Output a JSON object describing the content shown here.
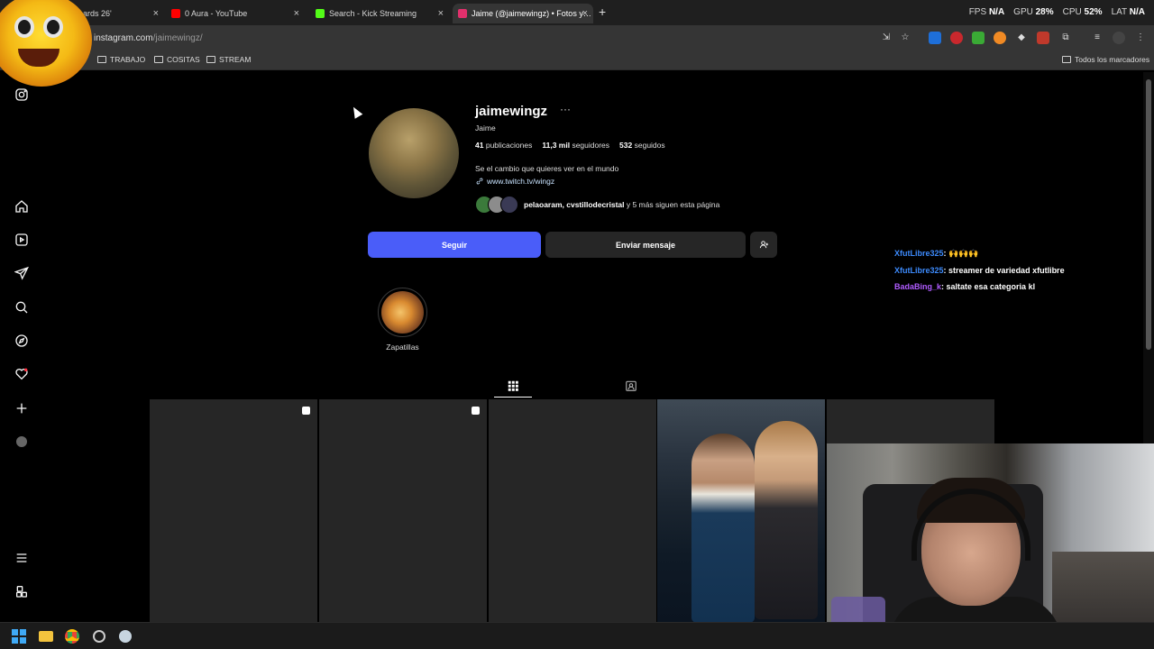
{
  "browser": {
    "tabs": [
      {
        "title": "ards 26'",
        "favicon_color": "#2c2c2c"
      },
      {
        "title": "0 Aura - YouTube",
        "favicon_color": "#ff0000"
      },
      {
        "title": "Search - Kick Streaming",
        "favicon_color": "#53fc18"
      },
      {
        "title": "Jaime (@jaimewingz) • Fotos y…",
        "favicon_color": "#e1306c"
      }
    ],
    "url_host": "instagram.com",
    "url_path": "/jaimewingz/",
    "bookmarks": [
      "TRABAJO",
      "COSITAS",
      "STREAM"
    ],
    "all_bookmarks": "Todos los marcadores"
  },
  "overlay_stats": {
    "fps_label": "FPS",
    "fps_value": "N/A",
    "gpu_label": "GPU",
    "gpu_value": "28%",
    "cpu_label": "CPU",
    "cpu_value": "52%",
    "lat_label": "LAT",
    "lat_value": "N/A"
  },
  "nav_icons": [
    "instagram-logo-icon",
    "home-icon",
    "reels-icon",
    "direct-messages-icon",
    "search-icon",
    "explore-icon",
    "notifications-icon",
    "create-icon",
    "profile-avatar",
    "menu-icon",
    "more-apps-icon"
  ],
  "profile": {
    "username": "jaimewingz",
    "more": "···",
    "full_name": "Jaime",
    "posts_count": "41",
    "posts_label": "publicaciones",
    "followers_count": "11,3 mil",
    "followers_label": "seguidores",
    "following_count": "532",
    "following_label": "seguidos",
    "bio": "Se el cambio que quieres ver en el mundo",
    "link": "www.twitch.tv/wingz",
    "followed_by_names": "pelaoaram, cvstillodecristal",
    "followed_by_rest": " y 5 más siguen esta página",
    "follow_button": "Seguir",
    "message_button": "Enviar mensaje",
    "highlights": [
      {
        "label": "Zapatillas"
      }
    ]
  },
  "chat": [
    {
      "user": "XfutLibre325",
      "sep": ": ",
      "message": "🙌🙌🙌",
      "color": "#3d8bfd"
    },
    {
      "user": "XfutLibre325",
      "sep": ": ",
      "message": "streamer de variedad xfutlibre",
      "color": "#3d8bfd"
    },
    {
      "user": "BadaBing_k",
      "sep": ": ",
      "message": "saltate esa categoria kl",
      "color": "#b05cff"
    }
  ],
  "colors": {
    "follow_button": "#4a5df9",
    "secondary_button": "#262626",
    "background": "#000000"
  }
}
